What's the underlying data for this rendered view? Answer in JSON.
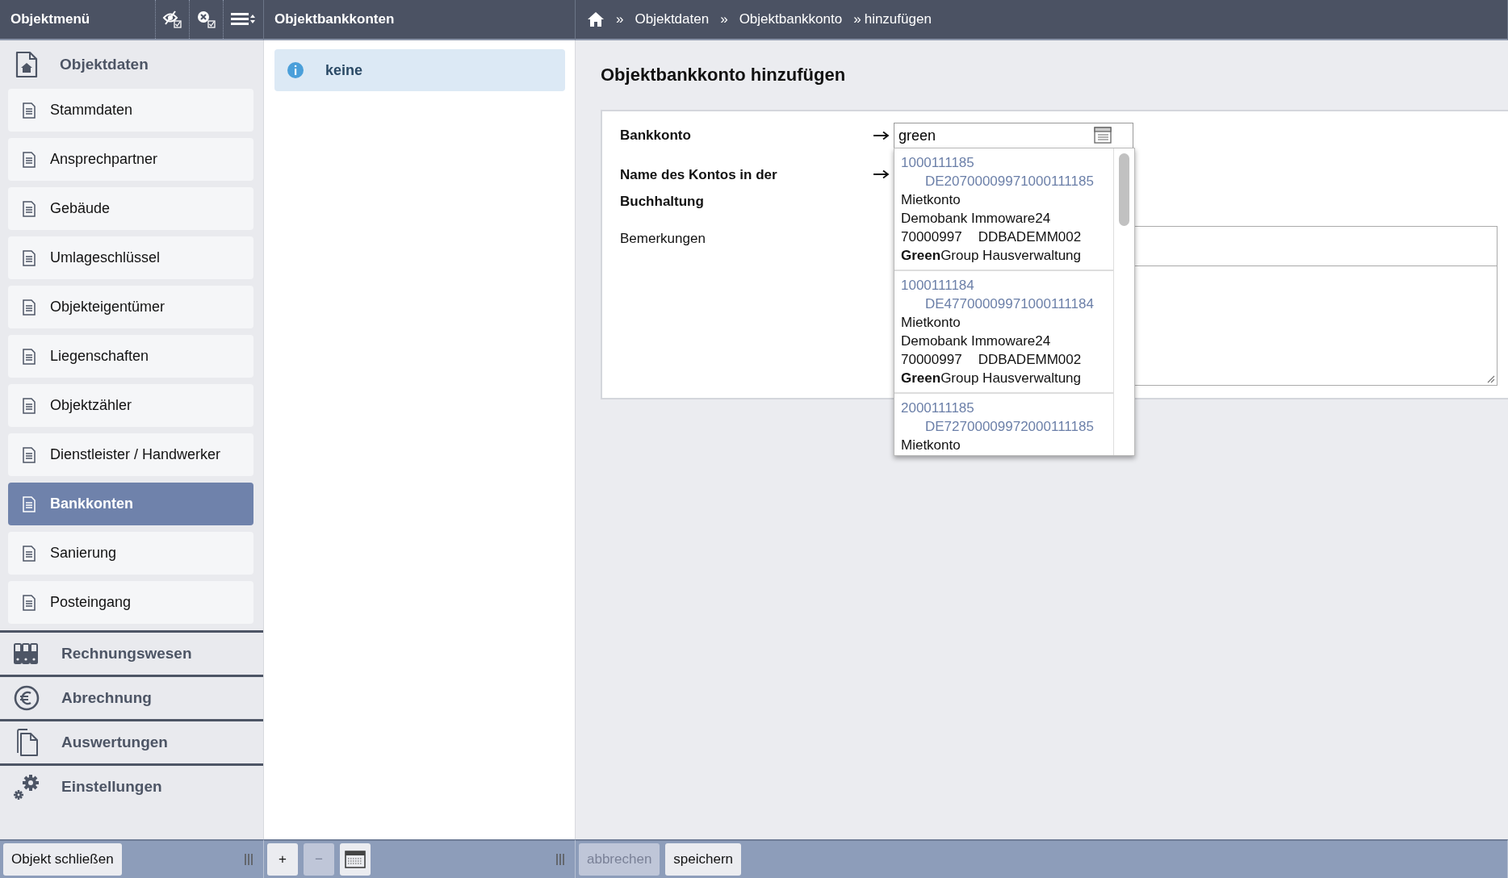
{
  "header": {
    "menu_title": "Objektmenü",
    "list_title": "Objektbankkonten",
    "crumbs": [
      {
        "separator": "»",
        "label": "Objektdaten"
      },
      {
        "separator": "»",
        "label": "Objektbankkonto"
      },
      {
        "separator": "»",
        "label": "hinzufügen"
      }
    ]
  },
  "sidebar": {
    "section": "Objektdaten",
    "items": [
      {
        "label": "Stammdaten",
        "selected": false
      },
      {
        "label": "Ansprechpartner",
        "selected": false
      },
      {
        "label": "Gebäude",
        "selected": false
      },
      {
        "label": "Umlageschlüssel",
        "selected": false
      },
      {
        "label": "Objekteigentümer",
        "selected": false
      },
      {
        "label": "Liegenschaften",
        "selected": false
      },
      {
        "label": "Objektzähler",
        "selected": false
      },
      {
        "label": "Dienstleister / Handwerker",
        "selected": false
      },
      {
        "label": "Bankkonten",
        "selected": true
      },
      {
        "label": "Sanierung",
        "selected": false
      },
      {
        "label": "Posteingang",
        "selected": false
      }
    ],
    "groups": [
      {
        "label": "Rechnungswesen",
        "kind": "binders"
      },
      {
        "label": "Abrechnung",
        "kind": "euro"
      },
      {
        "label": "Auswertungen",
        "kind": "pages"
      },
      {
        "label": "Einstellungen",
        "kind": "gears"
      }
    ]
  },
  "list": {
    "info": "keine"
  },
  "form": {
    "title": "Objektbankkonto hinzufügen",
    "fields": [
      {
        "label": "Bankkonto",
        "required": true,
        "kind": "lookup",
        "value": "green"
      },
      {
        "label": "Name des Kontos in der Buchhaltung",
        "required": true,
        "kind": "text"
      },
      {
        "label": "Bemerkungen",
        "required": false,
        "kind": "textarea"
      }
    ],
    "options": [
      {
        "number": "1000111185",
        "iban": "DE20700009971000111185",
        "lines": [
          "Mietkonto",
          "Demobank Immoware24"
        ],
        "blz": "70000997",
        "bic": "DDBADEMM002",
        "owner": "**Green**Group Hausverwaltung"
      },
      {
        "number": "1000111184",
        "iban": "DE47700009971000111184",
        "lines": [
          "Mietkonto",
          "Demobank Immoware24"
        ],
        "blz": "70000997",
        "bic": "DDBADEMM002",
        "owner": "**Green**Group Hausverwaltung"
      },
      {
        "number": "2000111185",
        "iban": "DE72700009972000111185",
        "lines": [
          "Mietkonto"
        ]
      }
    ]
  },
  "footer": {
    "left": [
      {
        "label": "Objekt schließen",
        "disabled": false
      }
    ],
    "middle": [
      {
        "kind": "text",
        "label": "+",
        "disabled": false
      },
      {
        "kind": "text",
        "label": "−",
        "disabled": true
      },
      {
        "kind": "calendar",
        "disabled": false
      }
    ],
    "right": [
      {
        "label": "abbrechen",
        "disabled": true
      },
      {
        "label": "speichern",
        "disabled": false
      }
    ]
  }
}
